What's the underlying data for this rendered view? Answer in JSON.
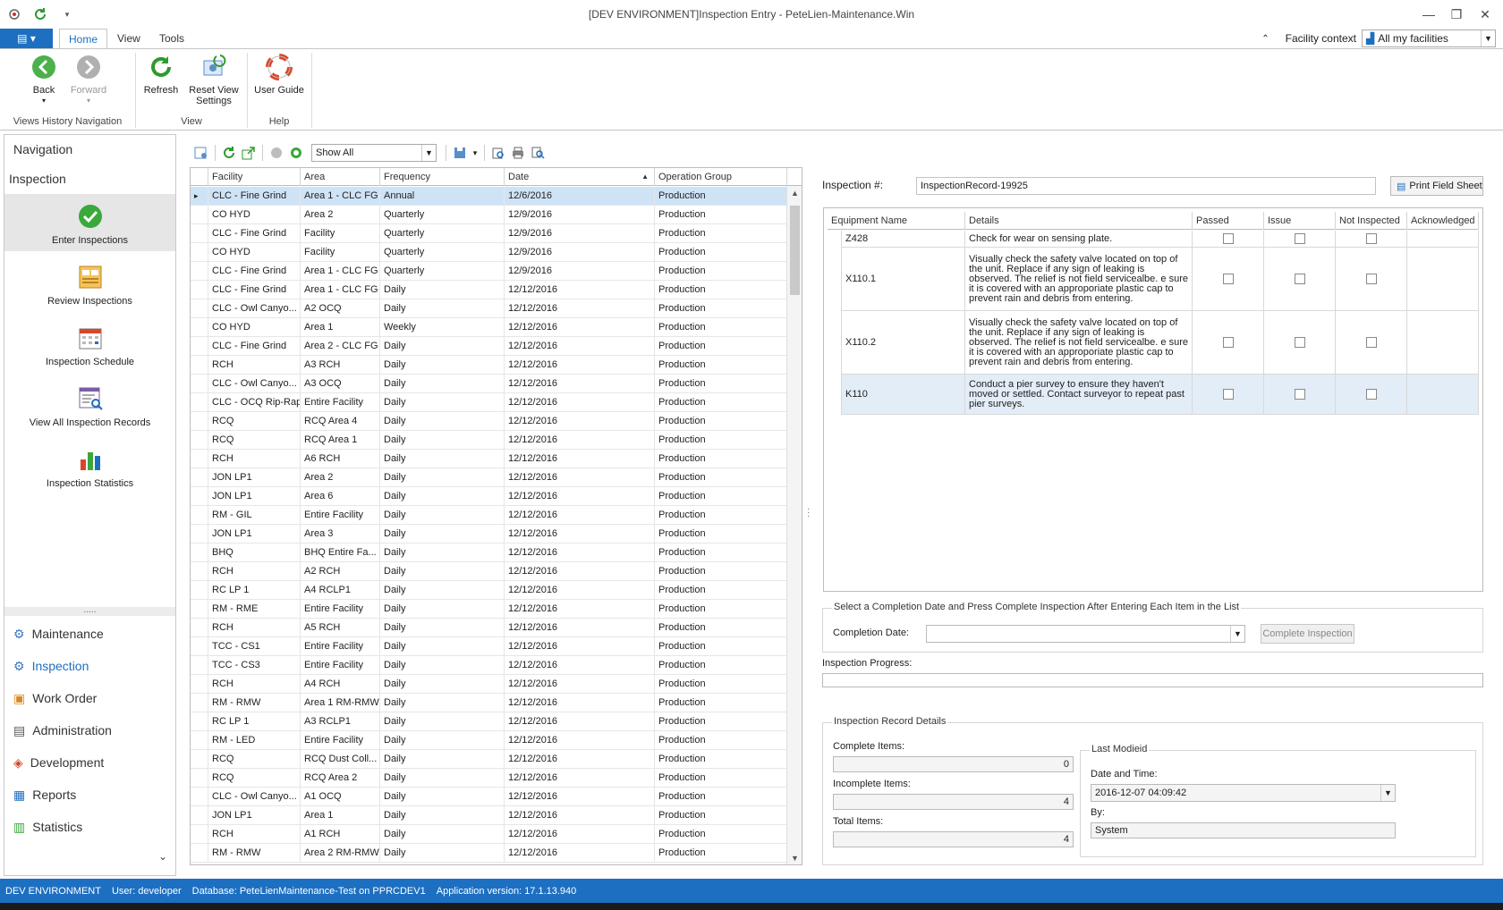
{
  "window": {
    "title": "[DEV ENVIRONMENT]Inspection Entry - PeteLien-Maintenance.Win"
  },
  "ribbon": {
    "tabs": [
      {
        "label": "Home",
        "active": true
      },
      {
        "label": "View",
        "active": false
      },
      {
        "label": "Tools",
        "active": false
      }
    ],
    "facility_context_label": "Facility context",
    "facility_context_value": "All my facilities",
    "buttons": {
      "back": "Back",
      "forward": "Forward",
      "refresh": "Refresh",
      "reset_view_settings": "Reset View Settings",
      "user_guide": "User Guide"
    },
    "groups": {
      "history": "Views History Navigation",
      "view": "View",
      "help": "Help"
    }
  },
  "navigation": {
    "title": "Navigation",
    "group_title": "Inspection",
    "items": [
      {
        "label": "Enter Inspections",
        "icon": "check-circle-icon",
        "selected": true
      },
      {
        "label": "Review Inspections",
        "icon": "review-icon",
        "selected": false
      },
      {
        "label": "Inspection Schedule",
        "icon": "calendar-icon",
        "selected": false
      },
      {
        "label": "View All Inspection Records",
        "icon": "records-search-icon",
        "selected": false
      },
      {
        "label": "Inspection Statistics",
        "icon": "bar-chart-icon",
        "selected": false
      }
    ],
    "modules": [
      {
        "label": "Maintenance",
        "active": false
      },
      {
        "label": "Inspection",
        "active": true
      },
      {
        "label": "Work Order",
        "active": false
      },
      {
        "label": "Administration",
        "active": false
      },
      {
        "label": "Development",
        "active": false
      },
      {
        "label": "Reports",
        "active": false
      },
      {
        "label": "Statistics",
        "active": false
      }
    ]
  },
  "grid_toolbar": {
    "filter_value": "Show All"
  },
  "grid": {
    "columns": [
      "Facility",
      "Area",
      "Frequency",
      "Date",
      "Operation Group"
    ],
    "rows": [
      [
        "CLC - Fine Grind",
        "Area 1 - CLC FG",
        "Annual",
        "12/6/2016",
        "Production"
      ],
      [
        "CO HYD",
        "Area 2",
        "Quarterly",
        "12/9/2016",
        "Production"
      ],
      [
        "CLC - Fine Grind",
        "Facility",
        "Quarterly",
        "12/9/2016",
        "Production"
      ],
      [
        "CO HYD",
        "Facility",
        "Quarterly",
        "12/9/2016",
        "Production"
      ],
      [
        "CLC - Fine Grind",
        "Area 1 - CLC FG",
        "Quarterly",
        "12/9/2016",
        "Production"
      ],
      [
        "CLC - Fine Grind",
        "Area 1 - CLC FG",
        "Daily",
        "12/12/2016",
        "Production"
      ],
      [
        "CLC - Owl Canyo...",
        "A2 OCQ",
        "Daily",
        "12/12/2016",
        "Production"
      ],
      [
        "CO HYD",
        "Area 1",
        "Weekly",
        "12/12/2016",
        "Production"
      ],
      [
        "CLC - Fine Grind",
        "Area 2 - CLC FG",
        "Daily",
        "12/12/2016",
        "Production"
      ],
      [
        "RCH",
        "A3 RCH",
        "Daily",
        "12/12/2016",
        "Production"
      ],
      [
        "CLC - Owl Canyo...",
        "A3 OCQ",
        "Daily",
        "12/12/2016",
        "Production"
      ],
      [
        "CLC - OCQ Rip-Rap",
        "Entire Facility",
        "Daily",
        "12/12/2016",
        "Production"
      ],
      [
        "RCQ",
        "RCQ Area 4",
        "Daily",
        "12/12/2016",
        "Production"
      ],
      [
        "RCQ",
        "RCQ Area 1",
        "Daily",
        "12/12/2016",
        "Production"
      ],
      [
        "RCH",
        "A6 RCH",
        "Daily",
        "12/12/2016",
        "Production"
      ],
      [
        "JON LP1",
        "Area 2",
        "Daily",
        "12/12/2016",
        "Production"
      ],
      [
        "JON LP1",
        "Area 6",
        "Daily",
        "12/12/2016",
        "Production"
      ],
      [
        "RM - GIL",
        "Entire Facility",
        "Daily",
        "12/12/2016",
        "Production"
      ],
      [
        "JON LP1",
        "Area 3",
        "Daily",
        "12/12/2016",
        "Production"
      ],
      [
        "BHQ",
        "BHQ Entire Fa...",
        "Daily",
        "12/12/2016",
        "Production"
      ],
      [
        "RCH",
        "A2 RCH",
        "Daily",
        "12/12/2016",
        "Production"
      ],
      [
        "RC LP 1",
        "A4 RCLP1",
        "Daily",
        "12/12/2016",
        "Production"
      ],
      [
        "RM - RME",
        "Entire Facility",
        "Daily",
        "12/12/2016",
        "Production"
      ],
      [
        "RCH",
        "A5 RCH",
        "Daily",
        "12/12/2016",
        "Production"
      ],
      [
        "TCC - CS1",
        "Entire Facility",
        "Daily",
        "12/12/2016",
        "Production"
      ],
      [
        "TCC - CS3",
        "Entire Facility",
        "Daily",
        "12/12/2016",
        "Production"
      ],
      [
        "RCH",
        "A4 RCH",
        "Daily",
        "12/12/2016",
        "Production"
      ],
      [
        "RM - RMW",
        "Area 1 RM-RMW",
        "Daily",
        "12/12/2016",
        "Production"
      ],
      [
        "RC LP 1",
        "A3 RCLP1",
        "Daily",
        "12/12/2016",
        "Production"
      ],
      [
        "RM - LED",
        "Entire Facility",
        "Daily",
        "12/12/2016",
        "Production"
      ],
      [
        "RCQ",
        "RCQ Dust Coll...",
        "Daily",
        "12/12/2016",
        "Production"
      ],
      [
        "RCQ",
        "RCQ Area 2",
        "Daily",
        "12/12/2016",
        "Production"
      ],
      [
        "CLC - Owl Canyo...",
        "A1 OCQ",
        "Daily",
        "12/12/2016",
        "Production"
      ],
      [
        "JON LP1",
        "Area 1",
        "Daily",
        "12/12/2016",
        "Production"
      ],
      [
        "RCH",
        "A1 RCH",
        "Daily",
        "12/12/2016",
        "Production"
      ],
      [
        "RM - RMW",
        "Area 2 RM-RMW",
        "Daily",
        "12/12/2016",
        "Production"
      ]
    ]
  },
  "inspection": {
    "number_label": "Inspection #:",
    "number_value": "InspectionRecord-19925",
    "print_button": "Print Field Sheet",
    "equipment_columns": [
      "Equipment Name",
      "Details",
      "Passed",
      "Issue",
      "Not Inspected",
      "Acknowledged"
    ],
    "equipment_rows": [
      {
        "name": "Z428",
        "details": "Check for wear on sensing plate."
      },
      {
        "name": "X110.1",
        "details": "Visually check the safety valve located on top of the unit.  Replace if any sign of leaking is observed.  The relief is not field servicealbe.  e sure it is covered with an approporiate plastic cap to prevent rain and debris from entering."
      },
      {
        "name": "X110.2",
        "details": "Visually check the safety valve located on top of the unit.  Replace if any sign of leaking is observed.  The relief is not field servicealbe.  e sure it is covered with an approporiate plastic cap to prevent rain and debris from entering."
      },
      {
        "name": "K110",
        "details": "Conduct a pier survey to ensure they haven't moved or settled.  Contact surveyor to repeat past pier surveys."
      }
    ],
    "completion_legend": "Select a Completion Date and Press Complete Inspection After Entering Each Item in the List",
    "completion_date_label": "Completion Date:",
    "completion_date_value": "",
    "complete_button": "Complete Inspection",
    "progress_label": "Inspection Progress:",
    "progress_fraction": 0,
    "details_legend": "Inspection Record Details",
    "complete_items_label": "Complete Items:",
    "complete_items_value": "0",
    "incomplete_items_label": "Incomplete Items:",
    "incomplete_items_value": "4",
    "total_items_label": "Total Items:",
    "total_items_value": "4",
    "last_modified_legend": "Last Modieid",
    "date_time_label": "Date and Time:",
    "date_time_value": "2016-12-07 04:09:42",
    "by_label": "By:",
    "by_value": "System"
  },
  "status_bar": {
    "environment": "DEV ENVIRONMENT",
    "user": "User: developer",
    "database": "Database: PeteLienMaintenance-Test on PPRCDEV1",
    "version": "Application version: 17.1.13.940"
  },
  "colors": {
    "accent": "#1d6fc1",
    "selected_row": "#cfe3f7"
  }
}
